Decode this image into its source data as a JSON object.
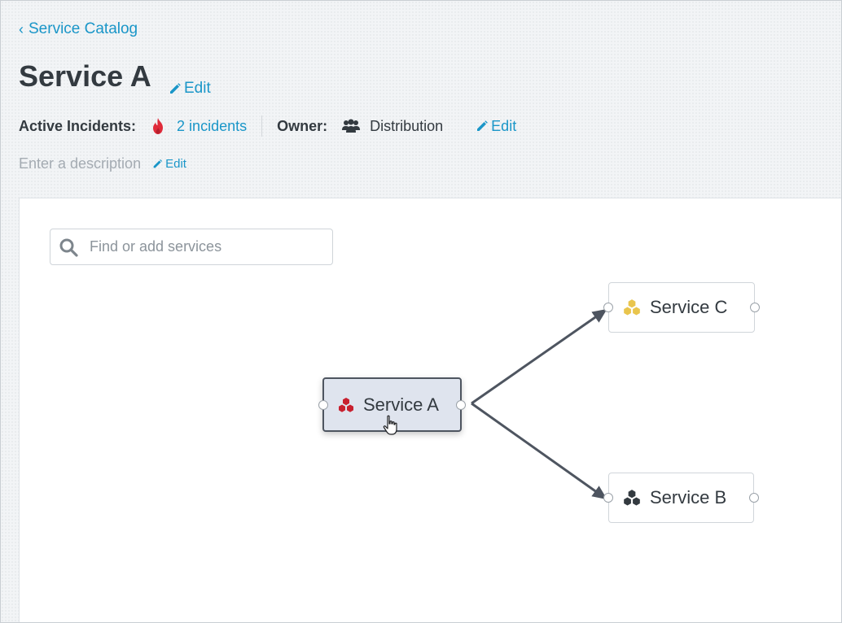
{
  "breadcrumb": {
    "label": "Service Catalog"
  },
  "service": {
    "title": "Service A",
    "edit_label": "Edit",
    "active_incidents_label": "Active Incidents:",
    "incidents_link": "2 incidents",
    "owner_label": "Owner:",
    "owner_value": "Distribution",
    "owner_edit_label": "Edit",
    "description_placeholder": "Enter a description",
    "description_edit_label": "Edit"
  },
  "search": {
    "placeholder": "Find or add services"
  },
  "graph": {
    "nodes": [
      {
        "name": "Service A",
        "icon": "hexagon-cluster-icon",
        "color": "#c8202f",
        "selected": true
      },
      {
        "name": "Service C",
        "icon": "hexagon-cluster-icon",
        "color": "#e9c54d",
        "selected": false
      },
      {
        "name": "Service B",
        "icon": "hexagon-cluster-icon",
        "color": "#333a40",
        "selected": false
      }
    ],
    "edges": [
      {
        "from": "Service A",
        "to": "Service C"
      },
      {
        "from": "Service A",
        "to": "Service B"
      }
    ]
  },
  "colors": {
    "accent": "#1a96c8",
    "fire": "#e02b3a",
    "text": "#333a40",
    "muted": "#a4abb2"
  }
}
